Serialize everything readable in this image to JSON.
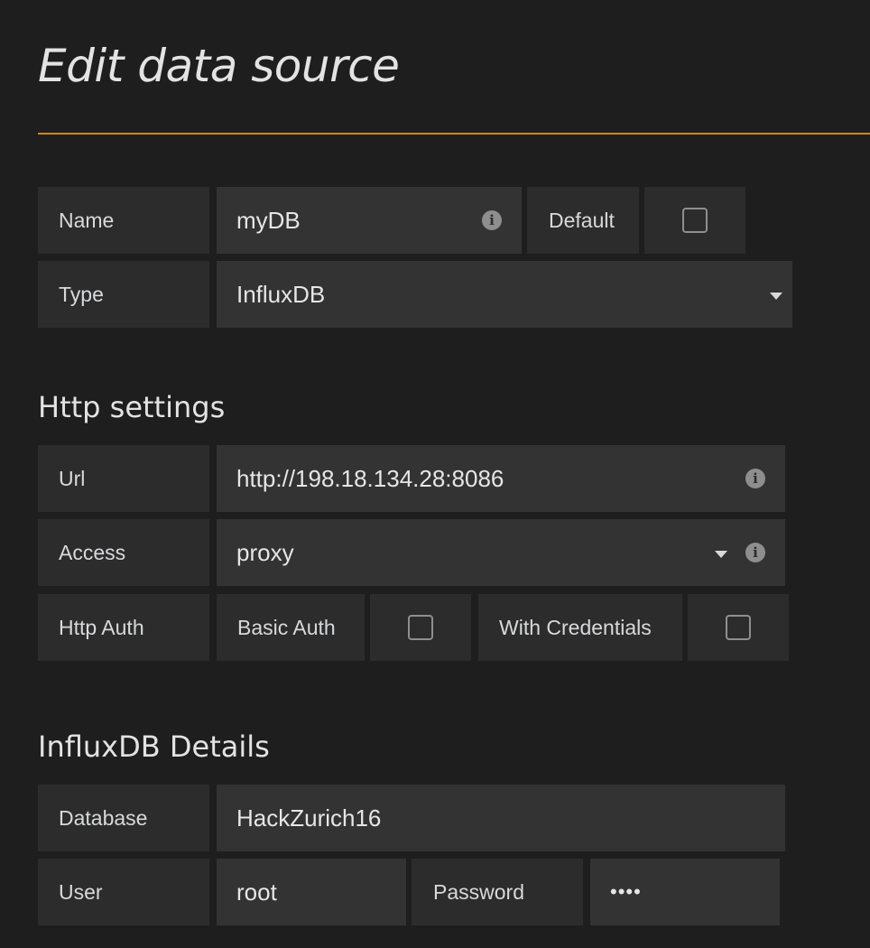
{
  "page": {
    "title": "Edit data source"
  },
  "general": {
    "name_label": "Name",
    "name_value": "myDB",
    "default_label": "Default",
    "default_checked": false,
    "type_label": "Type",
    "type_value": "InfluxDB"
  },
  "http": {
    "heading": "Http settings",
    "url_label": "Url",
    "url_value": "http://198.18.134.28:8086",
    "access_label": "Access",
    "access_value": "proxy",
    "auth_label": "Http Auth",
    "basic_auth_label": "Basic Auth",
    "basic_auth_checked": false,
    "with_credentials_label": "With Credentials",
    "with_credentials_checked": false
  },
  "influx": {
    "heading": "InfluxDB Details",
    "database_label": "Database",
    "database_value": "HackZurich16",
    "user_label": "User",
    "user_value": "root",
    "password_label": "Password",
    "password_value": "••••"
  },
  "icons": {
    "info": "info-icon",
    "caret": "caret-down-icon",
    "checkbox": "checkbox-icon"
  },
  "colors": {
    "accent": "#c98a1b",
    "background": "#1f1e1f",
    "label_bg": "#2c2c2d",
    "field_bg": "#333334"
  }
}
